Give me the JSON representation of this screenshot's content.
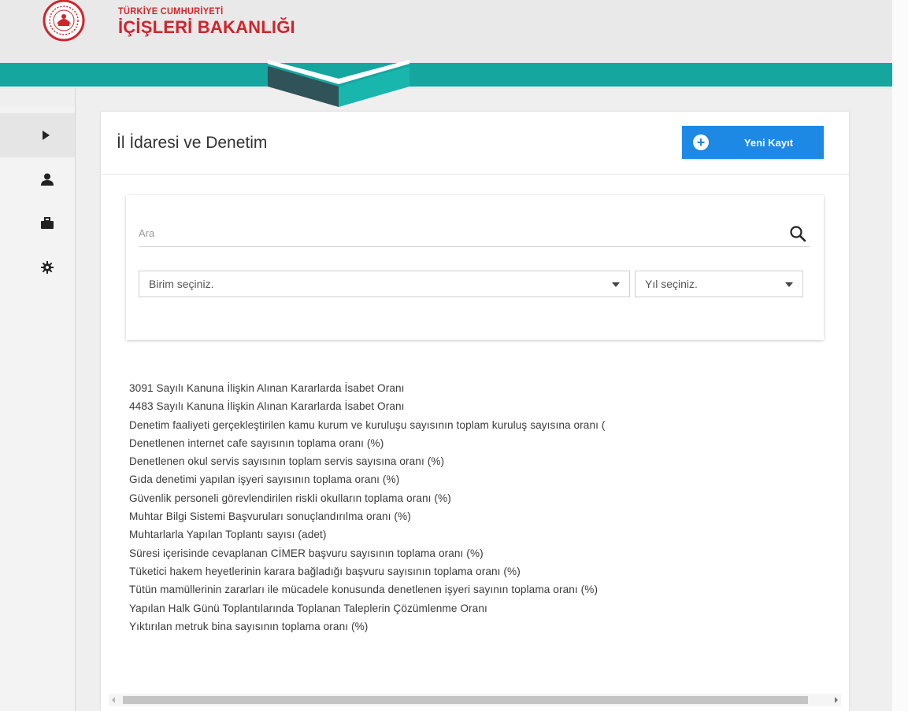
{
  "brand": {
    "subtitle": "TÜRKİYE CUMHURİYETİ",
    "title": "İÇİŞLERİ BAKANLIĞI",
    "red": "#d0242b"
  },
  "colors": {
    "teal": "#15a6a0",
    "dark_teal": "#2f5358",
    "accent_blue": "#1e88e5"
  },
  "sidebar": {
    "items": [
      {
        "icon": "play-icon",
        "active": true
      },
      {
        "icon": "user-icon",
        "active": false
      },
      {
        "icon": "briefcase-icon",
        "active": false
      },
      {
        "icon": "gear-icon",
        "active": false
      }
    ]
  },
  "page": {
    "title": "İl İdaresi ve Denetim",
    "new_button_label": "Yeni Kayıt"
  },
  "filter": {
    "search_placeholder": "Ara",
    "unit_select": "Birim seçiniz.",
    "year_select": "Yıl seçiniz."
  },
  "list": {
    "items": [
      "3091 Sayılı Kanuna İlişkin Alınan Kararlarda İsabet Oranı",
      "4483 Sayılı Kanuna İlişkin Alınan Kararlarda İsabet Oranı",
      "Denetim faaliyeti gerçekleştirilen kamu kurum ve kuruluşu sayısının toplam kuruluş sayısına oranı (",
      "Denetlenen internet cafe sayısının toplama oranı (%)",
      "Denetlenen okul servis sayısının toplam servis sayısına oranı (%)",
      "Gıda denetimi yapılan işyeri sayısının toplama oranı (%)",
      "Güvenlik personeli görevlendirilen riskli okulların toplama oranı (%)",
      "Muhtar Bilgi Sistemi Başvuruları sonuçlandırılma oranı (%)",
      "Muhtarlarla Yapılan Toplantı sayısı (adet)",
      "Süresi içerisinde cevaplanan CİMER başvuru sayısının toplama oranı (%)",
      "Tüketici hakem heyetlerinin karara bağladığı başvuru sayısının toplama oranı (%)",
      "Tütün mamüllerinin zararları ile mücadele konusunda denetlenen işyeri sayının toplama oranı (%)",
      "Yapılan Halk Günü Toplantılarında Toplanan Taleplerin Çözümlenme Oranı",
      "Yıktırılan metruk bina sayısının toplama oranı (%)"
    ]
  }
}
